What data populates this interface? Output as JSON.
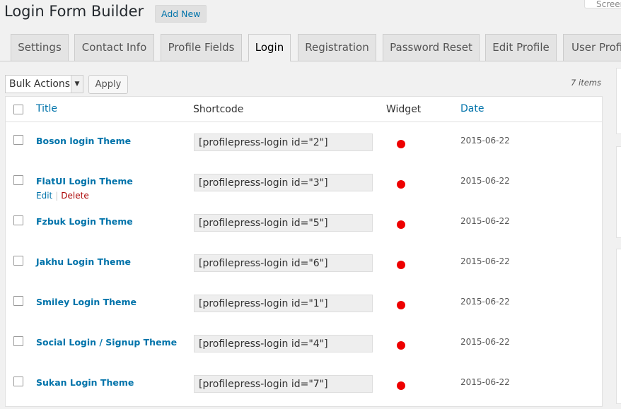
{
  "header": {
    "title": "Login Form Builder",
    "add_new": "Add New",
    "screen_options": "Screen Options"
  },
  "tabs": [
    {
      "label": "Settings"
    },
    {
      "label": "Contact Info"
    },
    {
      "label": "Profile Fields"
    },
    {
      "label": "Login"
    },
    {
      "label": "Registration"
    },
    {
      "label": "Password Reset"
    },
    {
      "label": "Edit Profile"
    },
    {
      "label": "User Profile"
    }
  ],
  "active_tab": "Login",
  "toolbar": {
    "bulk_actions": "Bulk Actions",
    "apply": "Apply",
    "items_count": "7 items"
  },
  "table": {
    "columns": {
      "title": "Title",
      "shortcode": "Shortcode",
      "widget": "Widget",
      "date": "Date"
    },
    "row_actions": {
      "edit": "Edit",
      "delete": "Delete"
    },
    "rows": [
      {
        "title": "Boson login Theme",
        "shortcode": "[profilepress-login id=\"2\"]",
        "widget_status_color": "#ee0000",
        "date": "2015-06-22"
      },
      {
        "title": "FlatUI Login Theme",
        "shortcode": "[profilepress-login id=\"3\"]",
        "widget_status_color": "#ee0000",
        "date": "2015-06-22"
      },
      {
        "title": "Fzbuk Login Theme",
        "shortcode": "[profilepress-login id=\"5\"]",
        "widget_status_color": "#ee0000",
        "date": "2015-06-22"
      },
      {
        "title": "Jakhu Login Theme",
        "shortcode": "[profilepress-login id=\"6\"]",
        "widget_status_color": "#ee0000",
        "date": "2015-06-22"
      },
      {
        "title": "Smiley Login Theme",
        "shortcode": "[profilepress-login id=\"1\"]",
        "widget_status_color": "#ee0000",
        "date": "2015-06-22"
      },
      {
        "title": "Social Login / Signup Theme",
        "shortcode": "[profilepress-login id=\"4\"]",
        "widget_status_color": "#ee0000",
        "date": "2015-06-22"
      },
      {
        "title": "Sukan Login Theme",
        "shortcode": "[profilepress-login id=\"7\"]",
        "widget_status_color": "#ee0000",
        "date": "2015-06-22"
      }
    ]
  },
  "colors": {
    "link": "#0073aa",
    "delete": "#aa0000",
    "status_red": "#ee0000"
  }
}
